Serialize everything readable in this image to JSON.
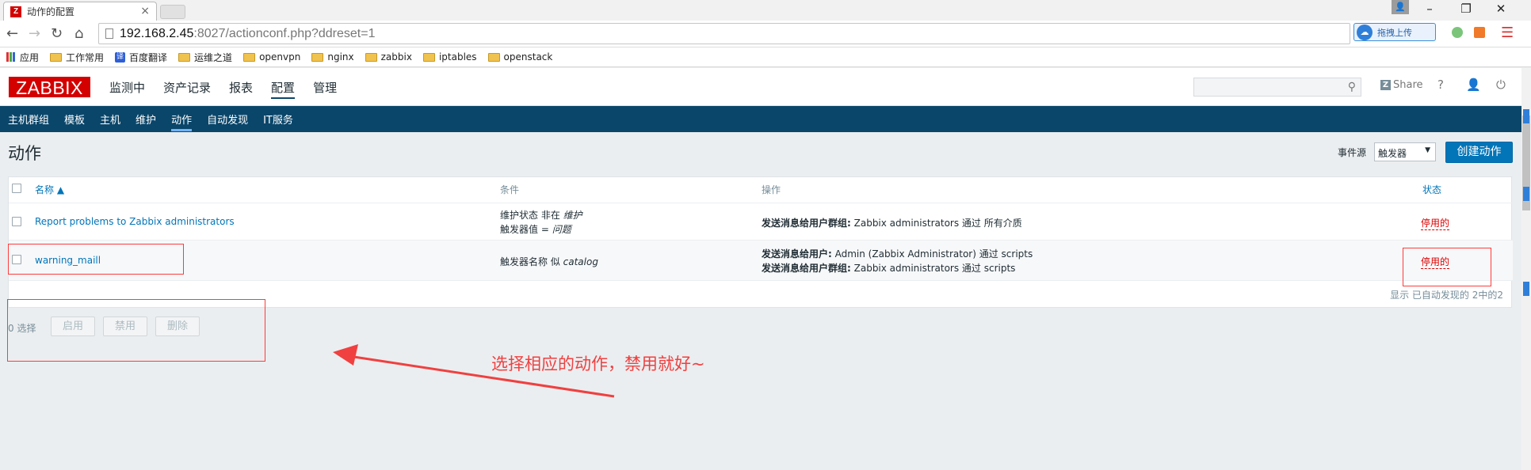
{
  "browser": {
    "tab_title": "动作的配置",
    "tab_favicon": "Z",
    "url_host": "192.168.2.45",
    "url_rest": ":8027/actionconf.php?ddreset=1",
    "upload_label": "拖拽上传",
    "bookmarks": [
      "应用",
      "工作常用",
      "百度翻译",
      "运维之道",
      "openvpn",
      "nginx",
      "zabbix",
      "iptables",
      "openstack"
    ]
  },
  "header": {
    "logo": "ZABBIX",
    "menu": [
      "监测中",
      "资产记录",
      "报表",
      "配置",
      "管理"
    ],
    "share_label": "Share",
    "help_label": "?"
  },
  "subnav": [
    "主机群组",
    "模板",
    "主机",
    "维护",
    "动作",
    "自动发现",
    "IT服务"
  ],
  "page": {
    "title": "动作",
    "event_source_label": "事件源",
    "event_source_value": "触发器",
    "create_button": "创建动作"
  },
  "table": {
    "headers": {
      "name": "名称 ▲",
      "conditions": "条件",
      "operations": "操作",
      "status": "状态"
    },
    "rows": [
      {
        "name": "Report problems to Zabbix administrators",
        "cond1_prefix": "维护状态 非在 ",
        "cond1_value": "维护",
        "cond2_prefix": "触发器值 = ",
        "cond2_value": "问题",
        "op1_bold": "发送消息给用户群组:",
        "op1_text": " Zabbix administrators 通过 所有介质",
        "status": "停用的"
      },
      {
        "name": "warning_maill",
        "cond1_prefix": "触发器名称 似 ",
        "cond1_value": "catalog",
        "op1_bold": "发送消息给用户:",
        "op1_text": " Admin (Zabbix Administrator) 通过 scripts",
        "op2_bold": "发送消息给用户群组:",
        "op2_text": " Zabbix administrators 通过 scripts",
        "status": "停用的"
      }
    ],
    "footer": "显示 已自动发现的 2中的2"
  },
  "actions": {
    "selected": "0 选择",
    "enable": "启用",
    "disable": "禁用",
    "delete": "删除"
  },
  "annotation": "选择相应的动作，禁用就好~",
  "colors": {
    "zabbix_red": "#d40000",
    "nav_blue": "#0a466a",
    "link_blue": "#0275b8",
    "annot_red": "#f04040"
  }
}
